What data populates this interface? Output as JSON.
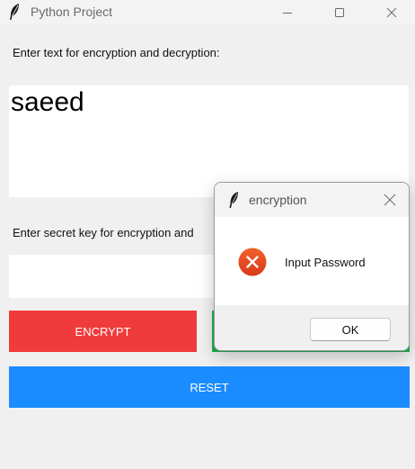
{
  "window": {
    "title": "Python Project",
    "icon": "feather-icon"
  },
  "main": {
    "text_label": "Enter text for encryption and decryption:",
    "text_value": "saeed",
    "key_label": "Enter secret key for encryption and",
    "key_value": "",
    "encrypt_label": "ENCRYPT",
    "reset_label": "RESET"
  },
  "dialog": {
    "title": "encryption",
    "message": "Input Password",
    "ok_label": "OK",
    "icon": "error-icon"
  },
  "colors": {
    "encrypt": "#ef3b3b",
    "decrypt": "#1fae52",
    "reset": "#1b8cff",
    "error": "#e84a1c"
  }
}
